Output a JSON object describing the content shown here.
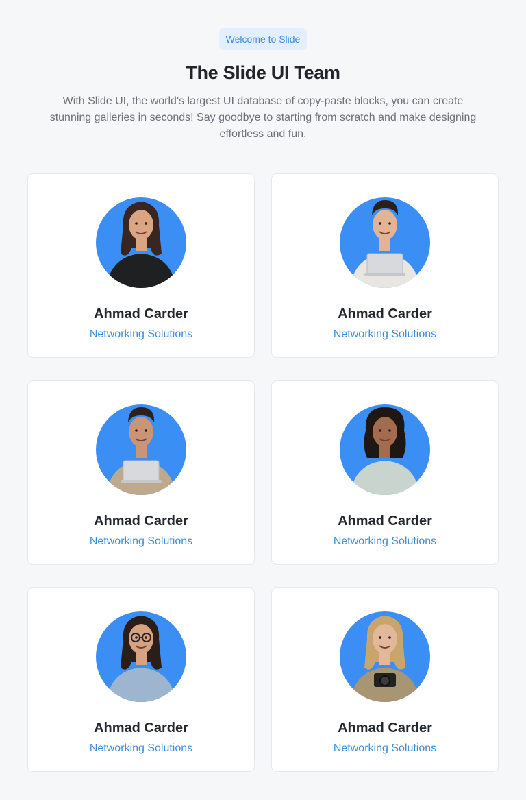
{
  "header": {
    "badge": "Welcome to Slide",
    "title": "The Slide UI Team",
    "description": "With Slide UI, the world's largest UI database of copy-paste blocks, you can create stunning galleries in seconds! Say goodbye to starting from scratch and make designing effortless and fun."
  },
  "accent_color": "#3b8ef3",
  "team": [
    {
      "name": "Ahmad Carder",
      "role": "Networking Solutions",
      "hair": "#3a2620",
      "skin": "#d9a583",
      "top": "#1f2022",
      "item": "none",
      "hair_style": "long"
    },
    {
      "name": "Ahmad Carder",
      "role": "Networking Solutions",
      "hair": "#2a211c",
      "skin": "#e2b394",
      "top": "#e9e6e1",
      "item": "laptop",
      "hair_style": "short"
    },
    {
      "name": "Ahmad Carder",
      "role": "Networking Solutions",
      "hair": "#2c211b",
      "skin": "#c99576",
      "top": "#bfa98c",
      "item": "laptop",
      "hair_style": "short"
    },
    {
      "name": "Ahmad Carder",
      "role": "Networking Solutions",
      "hair": "#1e1714",
      "skin": "#a36c4e",
      "top": "#c9d4cf",
      "item": "none",
      "hair_style": "curly"
    },
    {
      "name": "Ahmad Carder",
      "role": "Networking Solutions",
      "hair": "#2b1d17",
      "skin": "#d6a282",
      "top": "#9db5cf",
      "item": "glasses",
      "hair_style": "long"
    },
    {
      "name": "Ahmad Carder",
      "role": "Networking Solutions",
      "hair": "#c9a56e",
      "skin": "#e3b799",
      "top": "#a89572",
      "item": "camera",
      "hair_style": "long"
    }
  ]
}
